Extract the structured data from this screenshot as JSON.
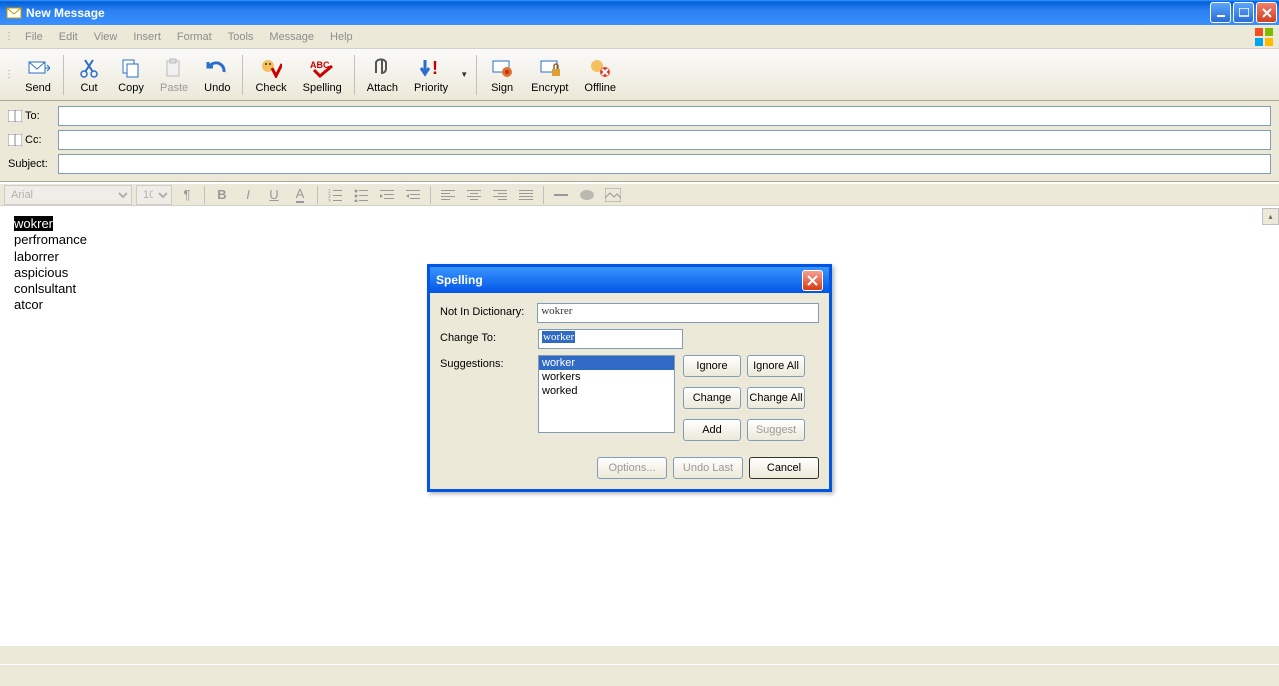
{
  "window": {
    "title": "New Message"
  },
  "menu": [
    "File",
    "Edit",
    "View",
    "Insert",
    "Format",
    "Tools",
    "Message",
    "Help"
  ],
  "toolbar": [
    {
      "id": "send",
      "label": "Send"
    },
    {
      "id": "cut",
      "label": "Cut"
    },
    {
      "id": "copy",
      "label": "Copy"
    },
    {
      "id": "paste",
      "label": "Paste",
      "disabled": true
    },
    {
      "id": "undo",
      "label": "Undo"
    },
    {
      "id": "check",
      "label": "Check"
    },
    {
      "id": "spelling",
      "label": "Spelling"
    },
    {
      "id": "attach",
      "label": "Attach"
    },
    {
      "id": "priority",
      "label": "Priority"
    },
    {
      "id": "sign",
      "label": "Sign"
    },
    {
      "id": "encrypt",
      "label": "Encrypt"
    },
    {
      "id": "offline",
      "label": "Offline"
    }
  ],
  "address": {
    "to_label": "To:",
    "cc_label": "Cc:",
    "subject_label": "Subject:",
    "to": "",
    "cc": "",
    "subject": ""
  },
  "format": {
    "font": "Arial",
    "size": "10"
  },
  "body_lines": [
    "wokrer",
    "perfromance",
    "laborrer",
    "aspicious",
    "conlsultant",
    "atcor"
  ],
  "body_highlight_index": 0,
  "spelling_dialog": {
    "title": "Spelling",
    "not_in_dict_label": "Not In Dictionary:",
    "not_in_dict_value": "wokrer",
    "change_to_label": "Change To:",
    "change_to_value": "worker",
    "suggestions_label": "Suggestions:",
    "suggestions": [
      "worker",
      "workers",
      "worked"
    ],
    "selected_suggestion_index": 0,
    "buttons": {
      "ignore": "Ignore",
      "ignore_all": "Ignore All",
      "change": "Change",
      "change_all": "Change All",
      "add": "Add",
      "suggest": "Suggest",
      "options": "Options...",
      "undo_last": "Undo Last",
      "cancel": "Cancel"
    }
  }
}
